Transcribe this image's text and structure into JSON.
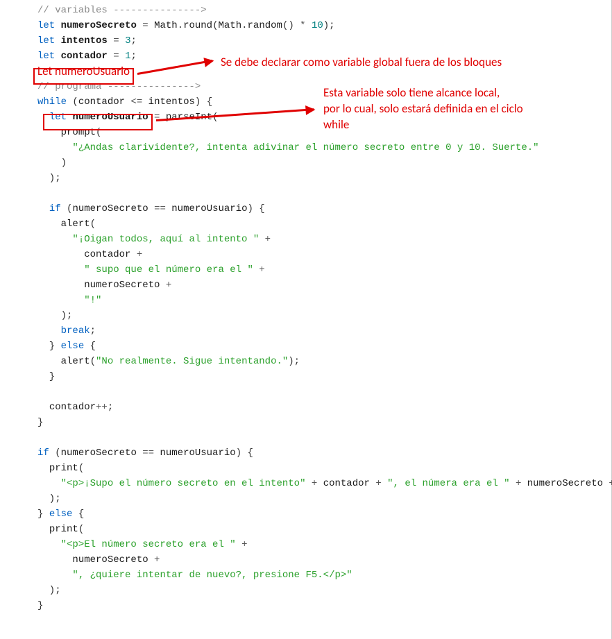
{
  "annotations": {
    "global": "Se debe declarar como variable global fuera de los bloques",
    "local1": "Esta variable solo tiene alcance local,",
    "local2": "por lo cual, solo estará definida en el ciclo",
    "local3": "while"
  },
  "code": {
    "l1": "// variables --------------->",
    "l2a": "let",
    "l2b": "numeroSecreto",
    "l2c": "Math",
    "l2d": "round",
    "l2e": "Math",
    "l2f": "random",
    "l2g": "10",
    "l3a": "let",
    "l3b": "intentos",
    "l3c": "3",
    "l4a": "let",
    "l4b": "contador",
    "l4c": "1",
    "l5red": "Let numeroUsuario",
    "l6": "// programa --------------->",
    "l7a": "while",
    "l7b": "contador",
    "l7c": "<=",
    "l7d": "intentos",
    "l8a": "let",
    "l8b": "numeroUsuario",
    "l8c": "parseInt",
    "l9": "prompt",
    "l10": "\"¿Andas clarividente?, intenta adivinar el número secreto entre 0 y 10. Suerte.\"",
    "l14a": "if",
    "l14b": "numeroSecreto",
    "l14c": "==",
    "l14d": "numeroUsuario",
    "l15": "alert",
    "l16": "\"¡Oigan todos, aquí al intento \"",
    "l17": "contador",
    "l18": "\" supo que el número era el \"",
    "l19": "numeroSecreto",
    "l20": "\"!\"",
    "l22": "break",
    "l23": "else",
    "l24a": "alert",
    "l24b": "\"No realmente. Sigue intentando.\"",
    "l27": "contador",
    "l30a": "if",
    "l30b": "numeroSecreto",
    "l30c": "==",
    "l30d": "numeroUsuario",
    "l31": "print",
    "l32a": "\"<p>¡Supo el número secreto en el intento\"",
    "l32b": "contador",
    "l32c": "\", el númera era el \"",
    "l32d": "numeroSecreto",
    "l34": "else",
    "l35": "print",
    "l36": "\"<p>El número secreto era el \"",
    "l37": "numeroSecreto",
    "l38": "\", ¿quiere intentar de nuevo?, presione F5.</p>\""
  }
}
